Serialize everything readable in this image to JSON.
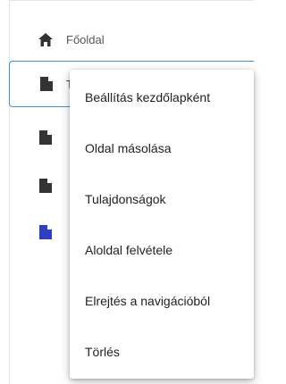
{
  "nav": {
    "home_label": "Főoldal",
    "items": [
      {
        "label": "T",
        "icon": "page-icon",
        "color": "#333333",
        "selected": true
      },
      {
        "label": "",
        "icon": "page-icon",
        "color": "#333333",
        "selected": false
      },
      {
        "label": "",
        "icon": "page-icon",
        "color": "#333333",
        "selected": false
      },
      {
        "label": "",
        "icon": "page-icon",
        "color": "#2e3fbf",
        "selected": false
      }
    ]
  },
  "context_menu": {
    "items": [
      "Beállítás kezdőlapként",
      "Oldal másolása",
      "Tulajdonságok",
      "Aloldal felvétele",
      "Elrejtés a navigációból",
      "Törlés"
    ]
  },
  "colors": {
    "selection_border": "#3b8fd9",
    "accent_page_icon": "#2e3fbf"
  }
}
